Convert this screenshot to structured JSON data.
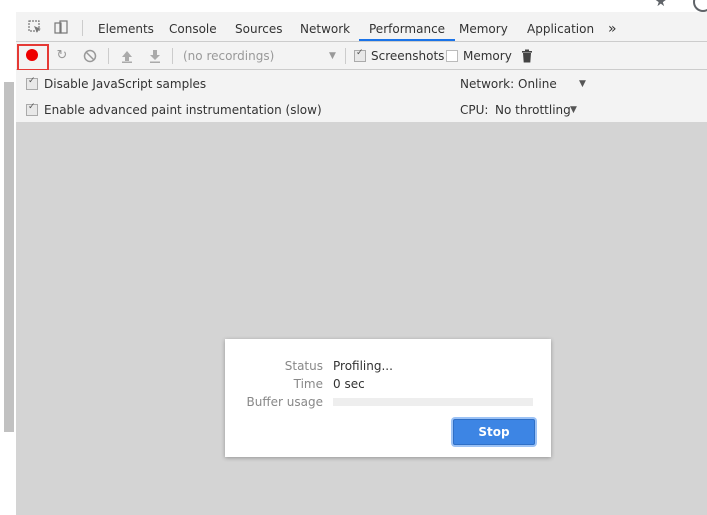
{
  "browser": {
    "star_icon": "star-icon",
    "reload_icon": "reload-icon"
  },
  "tabs": {
    "items": [
      {
        "label": "Elements"
      },
      {
        "label": "Console"
      },
      {
        "label": "Sources"
      },
      {
        "label": "Network"
      },
      {
        "label": "Performance",
        "active": true
      },
      {
        "label": "Memory"
      },
      {
        "label": "Application"
      }
    ],
    "more": "»"
  },
  "toolbar": {
    "record_state": "recording",
    "recordings_placeholder": "(no recordings)",
    "screenshots_label": "Screenshots",
    "screenshots_checked": true,
    "memory_label": "Memory",
    "memory_checked": false
  },
  "settings": {
    "disable_js_label": "Disable JavaScript samples",
    "disable_js_checked": true,
    "paint_label": "Enable advanced paint instrumentation (slow)",
    "paint_checked": true,
    "network_label": "Network:",
    "network_value": "Online",
    "cpu_label": "CPU:",
    "cpu_value": "No throttling"
  },
  "dialog": {
    "status_label": "Status",
    "status_value": "Profiling...",
    "time_label": "Time",
    "time_value": "0 sec",
    "buffer_label": "Buffer usage",
    "buffer_fraction": 0,
    "stop_label": "Stop"
  },
  "colors": {
    "record": "#ee0000",
    "accent": "#1a73e8",
    "stop_button": "#3d85e4",
    "highlight_box": "#e53935"
  }
}
